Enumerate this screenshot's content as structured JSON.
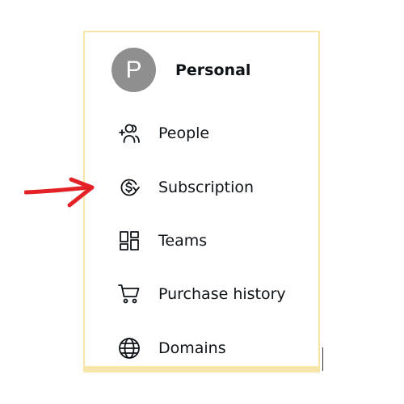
{
  "account": {
    "initial": "P",
    "name": "Personal"
  },
  "menu": {
    "items": [
      {
        "label": "People",
        "icon": "add-people-icon"
      },
      {
        "label": "Subscription",
        "icon": "subscription-icon"
      },
      {
        "label": "Teams",
        "icon": "teams-grid-icon"
      },
      {
        "label": "Purchase history",
        "icon": "shopping-cart-icon"
      },
      {
        "label": "Domains",
        "icon": "globe-icon"
      }
    ]
  },
  "annotation": {
    "arrow_color": "#e32227",
    "points_to": "Subscription"
  },
  "colors": {
    "panel_border": "#f7e6a8",
    "avatar_bg": "#8f8f8f"
  }
}
